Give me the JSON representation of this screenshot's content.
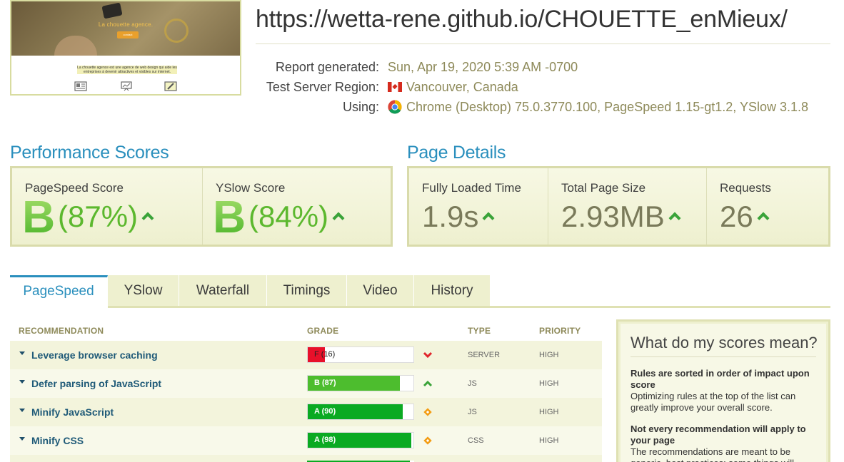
{
  "header": {
    "screenshot_title": "La chouette agence.",
    "screenshot_button": "contact",
    "screenshot_text": "La chouette agence est une agence de web design qui aide les entreprises à devenir attractives et visibles sur internet.",
    "url": "https://wetta-rene.github.io/CHOUETTE_enMieux/",
    "report_label": "Report generated:",
    "report_value": "Sun, Apr 19, 2020 5:39 AM -0700",
    "region_label": "Test Server Region:",
    "region_value": "Vancouver, Canada",
    "using_label": "Using:",
    "using_value": "Chrome (Desktop) 75.0.3770.100, PageSpeed 1.15-gt1.2, YSlow 3.1.8"
  },
  "performance": {
    "title": "Performance Scores",
    "pagespeed_label": "PageSpeed Score",
    "pagespeed_grade": "B",
    "pagespeed_pct": "(87%)",
    "yslow_label": "YSlow Score",
    "yslow_grade": "B",
    "yslow_pct": "(84%)"
  },
  "details": {
    "title": "Page Details",
    "loaded_label": "Fully Loaded Time",
    "loaded_value": "1.9s",
    "size_label": "Total Page Size",
    "size_value": "2.93MB",
    "requests_label": "Requests",
    "requests_value": "26"
  },
  "tabs": [
    "PageSpeed",
    "YSlow",
    "Waterfall",
    "Timings",
    "Video",
    "History"
  ],
  "table": {
    "headers": [
      "RECOMMENDATION",
      "GRADE",
      "TYPE",
      "PRIORITY"
    ],
    "rows": [
      {
        "name": "Leverage browser caching",
        "grade": "F (16)",
        "score": 16,
        "color": "#e8102a",
        "trend": "down",
        "type": "SERVER",
        "priority": "HIGH"
      },
      {
        "name": "Defer parsing of JavaScript",
        "grade": "B (87)",
        "score": 87,
        "color": "#4dbd2e",
        "trend": "up",
        "type": "JS",
        "priority": "HIGH"
      },
      {
        "name": "Minify JavaScript",
        "grade": "A (90)",
        "score": 90,
        "color": "#0aaa22",
        "trend": "same",
        "type": "JS",
        "priority": "HIGH"
      },
      {
        "name": "Minify CSS",
        "grade": "A (98)",
        "score": 98,
        "color": "#0aaa22",
        "trend": "same",
        "type": "CSS",
        "priority": "HIGH"
      }
    ]
  },
  "sidebar": {
    "title": "What do my scores mean?",
    "h1": "Rules are sorted in order of impact upon score",
    "p1": "Optimizing rules at the top of the list can greatly improve your overall score.",
    "h2": "Not every recommendation will apply to your page",
    "p2": "The recommendations are meant to be generic, best practices; some things will"
  },
  "colors": {
    "accent": "#2a8fbd",
    "panel_bg": "#eef0cf",
    "grade_green": "#5cb82e",
    "trend_up": "#3aa339",
    "trend_down": "#e0252b",
    "trend_same": "#f39c12"
  }
}
